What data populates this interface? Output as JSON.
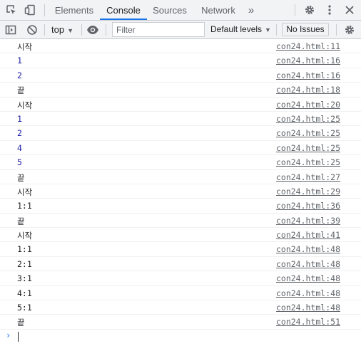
{
  "tabs": [
    {
      "label": "Elements",
      "active": false
    },
    {
      "label": "Console",
      "active": true
    },
    {
      "label": "Sources",
      "active": false
    },
    {
      "label": "Network",
      "active": false
    }
  ],
  "more_tabs_glyph": "»",
  "toolbar": {
    "context_label": "top",
    "filter_placeholder": "Filter",
    "levels_label": "Default levels",
    "issues_label": "No Issues"
  },
  "messages": [
    {
      "text": "시작",
      "source": "con24.html:11",
      "kind": "string"
    },
    {
      "text": "1",
      "source": "con24.html:16",
      "kind": "number"
    },
    {
      "text": "2",
      "source": "con24.html:16",
      "kind": "number"
    },
    {
      "text": "끝",
      "source": "con24.html:18",
      "kind": "string"
    },
    {
      "text": "시작",
      "source": "con24.html:20",
      "kind": "string"
    },
    {
      "text": "1",
      "source": "con24.html:25",
      "kind": "number"
    },
    {
      "text": "2",
      "source": "con24.html:25",
      "kind": "number"
    },
    {
      "text": "4",
      "source": "con24.html:25",
      "kind": "number"
    },
    {
      "text": "5",
      "source": "con24.html:25",
      "kind": "number"
    },
    {
      "text": "끝",
      "source": "con24.html:27",
      "kind": "string"
    },
    {
      "text": "시작",
      "source": "con24.html:29",
      "kind": "string"
    },
    {
      "text": "1:1",
      "source": "con24.html:36",
      "kind": "string"
    },
    {
      "text": "끝",
      "source": "con24.html:39",
      "kind": "string"
    },
    {
      "text": "시작",
      "source": "con24.html:41",
      "kind": "string"
    },
    {
      "text": "1:1",
      "source": "con24.html:48",
      "kind": "string"
    },
    {
      "text": "2:1",
      "source": "con24.html:48",
      "kind": "string"
    },
    {
      "text": "3:1",
      "source": "con24.html:48",
      "kind": "string"
    },
    {
      "text": "4:1",
      "source": "con24.html:48",
      "kind": "string"
    },
    {
      "text": "5:1",
      "source": "con24.html:48",
      "kind": "string"
    },
    {
      "text": "끝",
      "source": "con24.html:51",
      "kind": "string"
    }
  ],
  "prompt_glyph": "›",
  "colors": {
    "accent": "#1a73e8",
    "number": "#1a1aa6"
  }
}
